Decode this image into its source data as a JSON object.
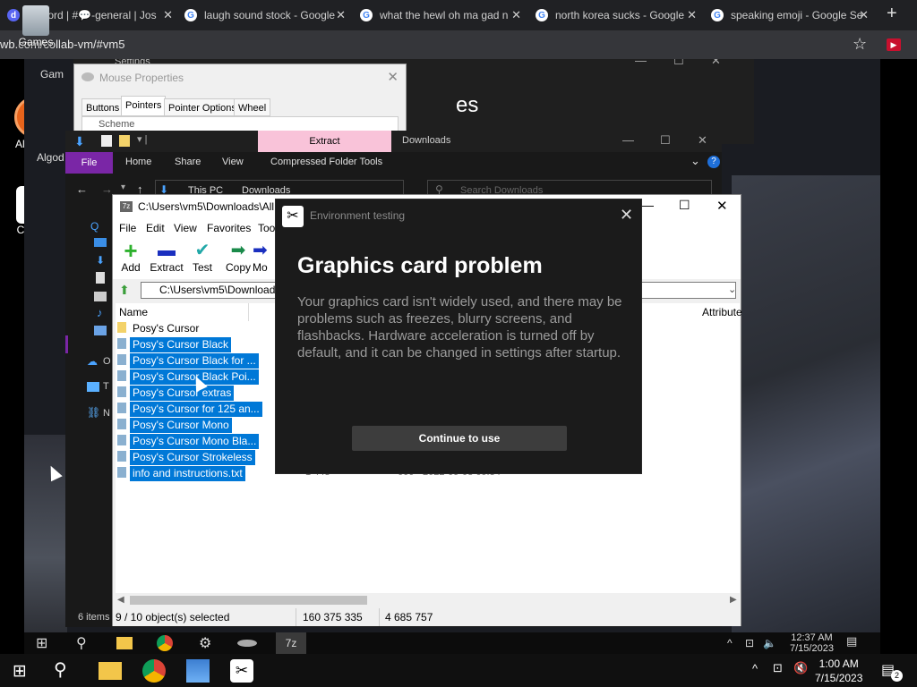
{
  "browser": {
    "tabs": [
      {
        "title": "Discord | #💬-general | Jos"
      },
      {
        "title": "laugh sound stock - Google"
      },
      {
        "title": "what the hewl oh ma gad n"
      },
      {
        "title": "north korea sucks - Google"
      },
      {
        "title": "speaking emoji - Google Se"
      }
    ],
    "new_tab_label": "+",
    "address": "wb.com/collab-vm/#vm5"
  },
  "host_desktop": {
    "icons": [
      {
        "label": "Games"
      },
      {
        "label": "Algodoo"
      },
      {
        "label": "CapCut"
      }
    ]
  },
  "vm": {
    "desktop_labels": {
      "gam": "Gam",
      "algod": "Algod"
    },
    "settings": {
      "title": "Settings",
      "fragment": "es"
    },
    "mouse_properties": {
      "title": "Mouse Properties",
      "tabs": [
        "Buttons",
        "Pointers",
        "Pointer Options",
        "Wheel"
      ],
      "scheme_label": "Scheme"
    },
    "explorer": {
      "extract_tab": "Extract",
      "window_title": "Downloads",
      "ribbon_tabs": [
        "File",
        "Home",
        "Share",
        "View",
        "Compressed Folder Tools"
      ],
      "path": [
        "This PC",
        "Downloads"
      ],
      "search_placeholder": "Search Downloads",
      "status": "6 items",
      "nav_letters": [
        "Q",
        "O",
        "T",
        "N"
      ]
    },
    "sevenzip": {
      "title": "C:\\Users\\vm5\\Downloads\\All P",
      "menu": [
        "File",
        "Edit",
        "View",
        "Favorites",
        "Tools"
      ],
      "toolbar": [
        "Add",
        "Extract",
        "Test",
        "Copy",
        "Mo"
      ],
      "path": "C:\\Users\\vm5\\Downloads",
      "columns": {
        "name": "Name",
        "attributes": "Attribute"
      },
      "files": [
        {
          "name": "Posy's Cursor",
          "selected": false,
          "folder": true
        },
        {
          "name": "Posy's Cursor Black",
          "selected": true
        },
        {
          "name": "Posy's Cursor Black for ...",
          "selected": true
        },
        {
          "name": "Posy's Cursor Black Poi...",
          "selected": true
        },
        {
          "name": "Posy's Cursor extras",
          "selected": true
        },
        {
          "name": "Posy's Cursor for 125 an...",
          "selected": true
        },
        {
          "name": "Posy's Cursor Mono",
          "selected": true
        },
        {
          "name": "Posy's Cursor Mono Bla...",
          "selected": true
        },
        {
          "name": "Posy's Cursor Strokeless",
          "selected": true
        },
        {
          "name": "info and instructions.txt",
          "selected": true
        }
      ],
      "partial_row": {
        "size": "1 443",
        "packed": "600",
        "date": "2022-09-08 09:34"
      },
      "status": {
        "selected": "9 / 10 object(s) selected",
        "size": "160 375 335",
        "packed": "4 685 757"
      }
    },
    "dialog": {
      "app_title": "Environment testing",
      "heading": "Graphics card problem",
      "body": "Your graphics card isn't widely used, and there may be problems such as freezes, blurry screens, and flashbacks. Hardware acceleration is turned off by default, and it can be changed in settings after startup.",
      "button": "Continue to use"
    },
    "taskbar": {
      "clock_time": "12:37 AM",
      "clock_date": "7/15/2023",
      "app_label": "7z"
    }
  },
  "host_taskbar": {
    "time": "1:00 AM",
    "date": "7/15/2023",
    "notification_count": "2"
  }
}
